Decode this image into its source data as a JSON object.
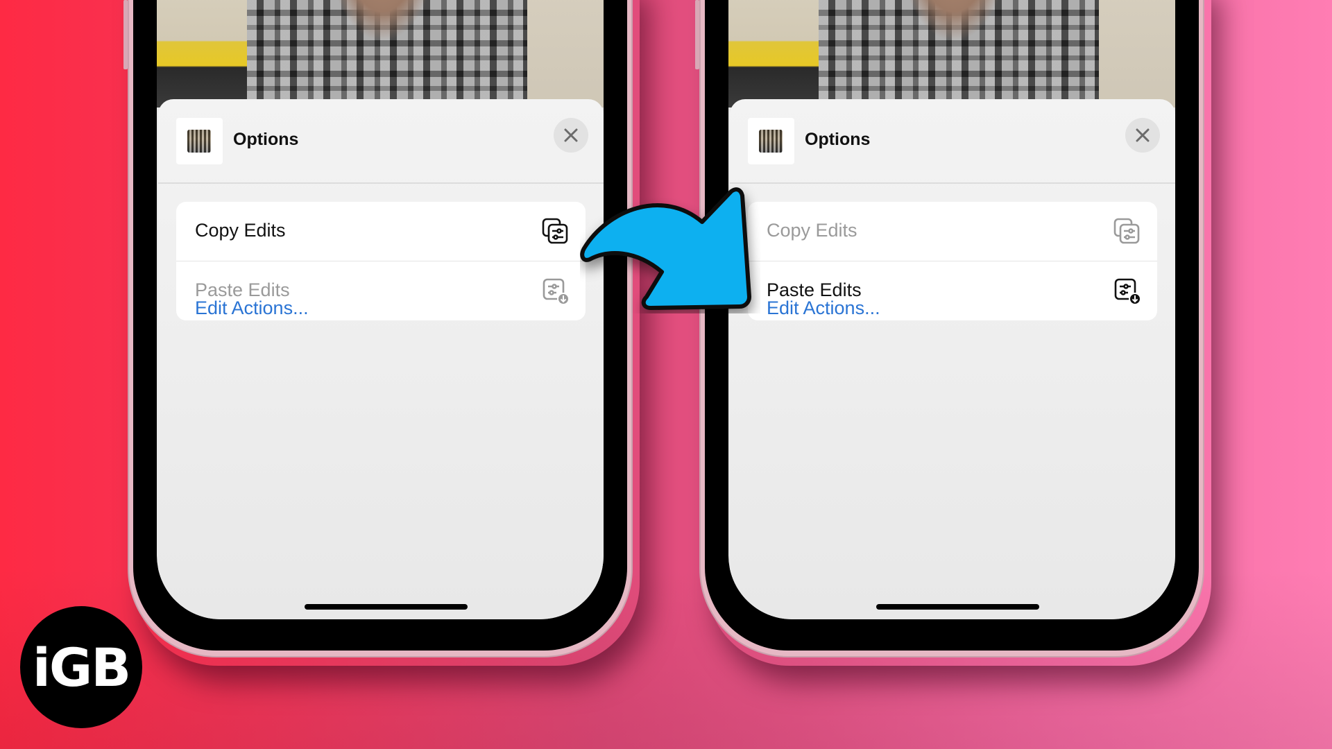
{
  "colors": {
    "arrow": "#0bb0f0",
    "link": "#2a74d4",
    "logo_bg": "#000000",
    "bg_left": "#fe2a44",
    "bg_right": "#ff7db3"
  },
  "logo": {
    "text": "iGB"
  },
  "arrow": {
    "icon": "curved-arrow-right"
  },
  "phones": [
    {
      "sheet_title": "Options",
      "close_icon": "xmark",
      "rows": [
        {
          "label": "Copy Edits",
          "icon": "copy-edits-icon",
          "state": "enabled"
        },
        {
          "label": "Paste Edits",
          "icon": "paste-edits-icon",
          "state": "disabled"
        }
      ],
      "link": "Edit Actions..."
    },
    {
      "sheet_title": "Options",
      "close_icon": "xmark",
      "rows": [
        {
          "label": "Copy Edits",
          "icon": "copy-edits-icon",
          "state": "disabled"
        },
        {
          "label": "Paste Edits",
          "icon": "paste-edits-icon",
          "state": "enabled"
        }
      ],
      "link": "Edit Actions..."
    }
  ]
}
